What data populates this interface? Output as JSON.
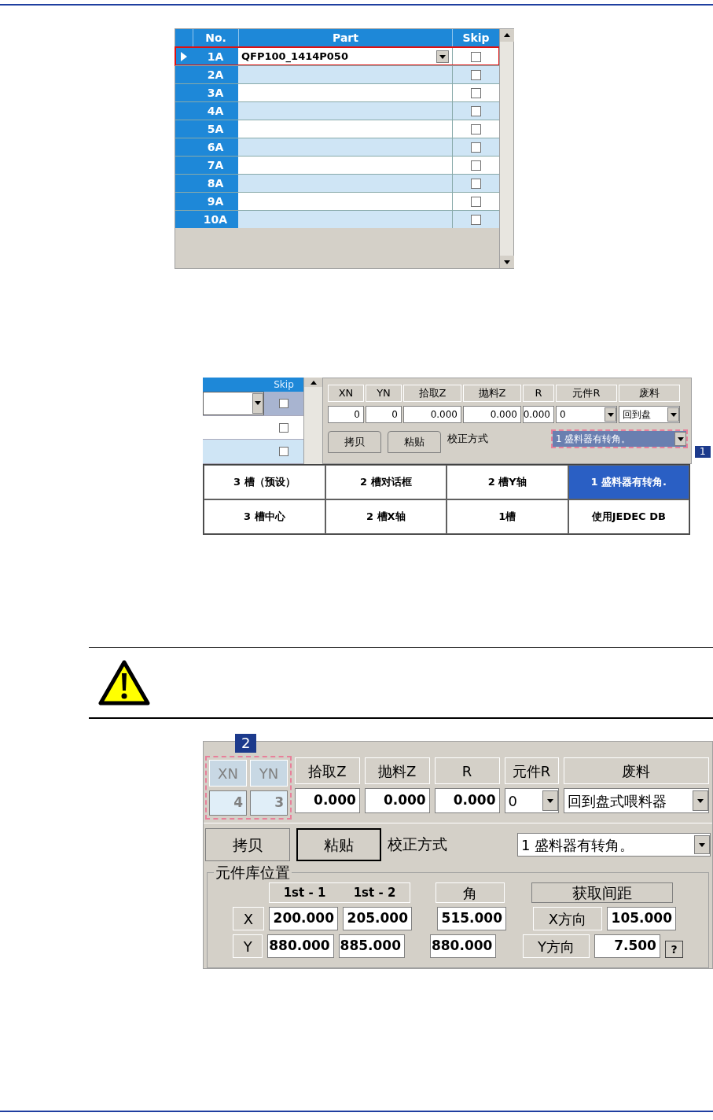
{
  "figure_1": {
    "columns": [
      "No.",
      "Part",
      "Skip"
    ],
    "rows": [
      {
        "no": "1A",
        "part": "QFP100_1414P050",
        "skip": false,
        "selected": true
      },
      {
        "no": "2A",
        "skip": false,
        "selected": false
      },
      {
        "no": "3A",
        "skip": false,
        "selected": false
      },
      {
        "no": "4A",
        "skip": false,
        "selected": false
      },
      {
        "no": "5A",
        "skip": false,
        "selected": false
      },
      {
        "no": "6A",
        "skip": false,
        "selected": false
      },
      {
        "no": "7A",
        "skip": false,
        "selected": false
      },
      {
        "no": "8A",
        "skip": false,
        "selected": false
      },
      {
        "no": "9A",
        "skip": false,
        "selected": false
      },
      {
        "no": "10A",
        "skip": false,
        "selected": false
      }
    ]
  },
  "figure_2": {
    "grid_fragment": {
      "column": "Skip",
      "rows": [
        {
          "skip": false,
          "selected": true
        },
        {
          "skip": false,
          "selected": false
        },
        {
          "skip": false,
          "selected": false
        }
      ]
    },
    "fields": [
      {
        "label": "XN",
        "value": "0",
        "kind": "text",
        "disabled": false
      },
      {
        "label": "YN",
        "value": "0",
        "kind": "text",
        "disabled": false
      },
      {
        "label": "拾取Z",
        "value": "0.000",
        "kind": "text",
        "disabled": false
      },
      {
        "label": "抛料Z",
        "value": "0.000",
        "kind": "text",
        "disabled": false
      },
      {
        "label": "R",
        "value": "0.000",
        "kind": "text",
        "disabled": false
      },
      {
        "label": "元件R",
        "value": "0",
        "kind": "dropdown",
        "disabled": false
      },
      {
        "label": "废料",
        "value": "回到盘",
        "kind": "dropdown",
        "disabled": false
      }
    ],
    "buttons": [
      {
        "label": "拷贝",
        "default": false
      },
      {
        "label": "粘贴",
        "default": false
      }
    ],
    "method_label": "校正方式",
    "method": {
      "value": "1 盛料器有转角。",
      "callout": "1"
    },
    "options": [
      {
        "label": "3 槽（预设）",
        "selected": false
      },
      {
        "label": "2 槽对话框",
        "selected": false
      },
      {
        "label": "2 槽Y轴",
        "selected": false
      },
      {
        "label": "1 盛料器有转角.",
        "selected": true
      },
      {
        "label": "3 槽中心",
        "selected": false
      },
      {
        "label": "2 槽X轴",
        "selected": false
      },
      {
        "label": "1槽",
        "selected": false
      },
      {
        "label": "使用JEDEC DB",
        "selected": false
      }
    ]
  },
  "figure_3": {
    "xy_callout": "2",
    "fields": [
      {
        "label": "XN",
        "value": "4",
        "kind": "text",
        "disabled": true
      },
      {
        "label": "YN",
        "value": "3",
        "kind": "text",
        "disabled": true
      },
      {
        "label": "拾取Z",
        "value": "0.000",
        "kind": "text",
        "disabled": false
      },
      {
        "label": "抛料Z",
        "value": "0.000",
        "kind": "text",
        "disabled": false
      },
      {
        "label": "R",
        "value": "0.000",
        "kind": "text",
        "disabled": false
      },
      {
        "label": "元件R",
        "value": "0",
        "kind": "dropdown",
        "disabled": false
      },
      {
        "label": "废料",
        "value": "回到盘式喂料器",
        "kind": "dropdown",
        "disabled": false
      }
    ],
    "buttons": [
      {
        "label": "拷贝",
        "default": false
      },
      {
        "label": "粘贴",
        "default": true
      }
    ],
    "method_label": "校正方式",
    "method": {
      "value": "1 盛料器有转角。"
    },
    "library": {
      "title": "元件库位置",
      "columns": [
        "1st - 1",
        "1st - 2",
        "角"
      ],
      "pitch_button": "获取间距",
      "rows": [
        {
          "axis": "X",
          "values": [
            "200.000",
            "205.000",
            "515.000"
          ],
          "pitch_label": "X方向",
          "pitch": "105.000"
        },
        {
          "axis": "Y",
          "values": [
            "880.000",
            "885.000",
            "880.000"
          ],
          "pitch_label": "Y方向",
          "pitch": "7.500"
        }
      ],
      "help": "?"
    }
  }
}
